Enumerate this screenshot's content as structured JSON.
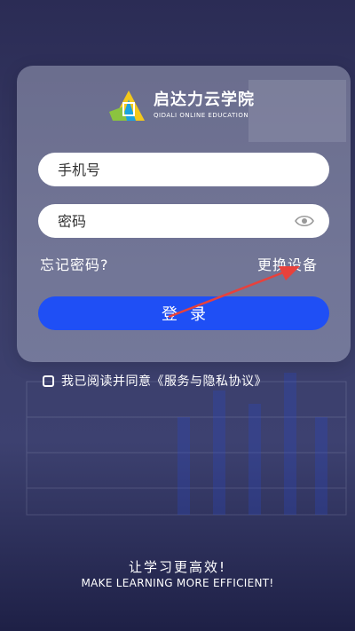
{
  "brand": {
    "name_cn": "启达力云学院",
    "name_en": "QIDALI ONLINE EDUCATION"
  },
  "form": {
    "phone_placeholder": "手机号",
    "password_placeholder": "密码",
    "forgot_password": "忘记密码?",
    "change_device": "更换设备",
    "login_button": "登录"
  },
  "agreement": {
    "text": "我已阅读并同意《服务与隐私协议》"
  },
  "slogan": {
    "cn": "让学习更高效!",
    "en": "MAKE LEARNING MORE EFFICIENT!"
  },
  "colors": {
    "primary": "#1f4ff5",
    "annotation_arrow": "#e8413c"
  },
  "icons": {
    "password_toggle": "eye-icon",
    "agreement_checkbox": "checkbox-icon",
    "logo": "logo-icon"
  }
}
